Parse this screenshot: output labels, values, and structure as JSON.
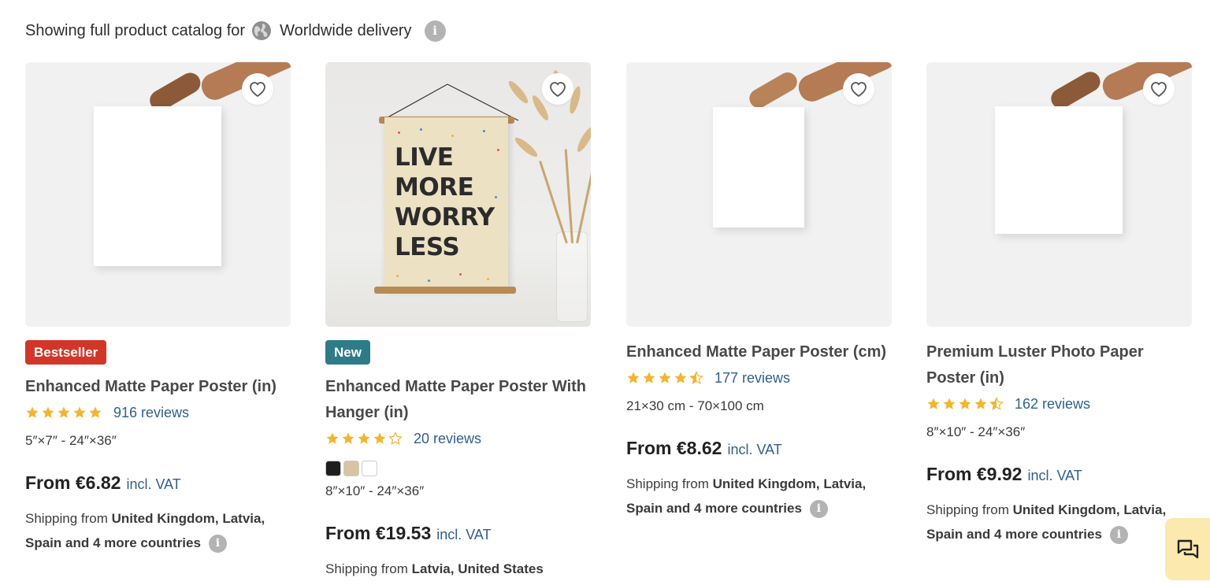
{
  "header": {
    "prefix": "Showing full product catalog for",
    "region": "Worldwide delivery"
  },
  "products": [
    {
      "badge": "Bestseller",
      "title": "Enhanced Matte Paper Poster (in)",
      "rating": 5,
      "reviews": "916 reviews",
      "sizes": "5″×7″ - 24″×36″",
      "price": "From €6.82",
      "vat": "incl. VAT",
      "ship_prefix": "Shipping from",
      "ship_countries": "United Kingdom, Latvia, Spain and 4 more countries"
    },
    {
      "badge": "New",
      "title": "Enhanced Matte Paper Poster With Hanger (in)",
      "rating": 4,
      "reviews": "20 reviews",
      "colors": [
        "#1e1e1e",
        "#d8c4a1",
        "#ffffff"
      ],
      "sizes": "8″×10″ - 24″×36″",
      "price": "From €19.53",
      "vat": "incl. VAT",
      "ship_prefix": "Shipping from",
      "ship_countries": "Latvia, United States",
      "image_text": [
        "LIVE",
        "MORE",
        "WORRY",
        "LESS"
      ]
    },
    {
      "title": "Enhanced Matte Paper Poster (cm)",
      "rating": 4.5,
      "reviews": "177 reviews",
      "sizes": "21×30 cm - 70×100 cm",
      "price": "From €8.62",
      "vat": "incl. VAT",
      "ship_prefix": "Shipping from",
      "ship_countries": "United Kingdom, Latvia, Spain and 4 more countries"
    },
    {
      "title": "Premium Luster Photo Paper Poster (in)",
      "rating": 4.5,
      "reviews": "162 reviews",
      "sizes": "8″×10″ - 24″×36″",
      "price": "From €9.92",
      "vat": "incl. VAT",
      "ship_prefix": "Shipping from",
      "ship_countries": "United Kingdom, Latvia, Spain and 4 more countries"
    }
  ],
  "icons": {
    "favorite": "heart-icon",
    "info": "info-icon",
    "region": "globe-icon",
    "chat": "chat-icon"
  },
  "colors": {
    "bestseller": "#d13628",
    "new": "#2e7b88",
    "star": "#f2b52f",
    "link": "#31608a",
    "chat_bg": "#fbe9ad"
  }
}
